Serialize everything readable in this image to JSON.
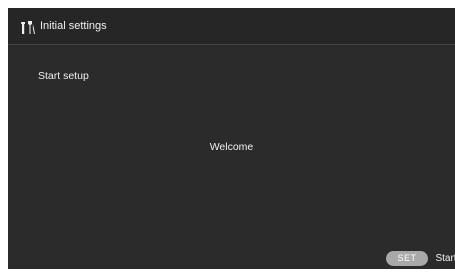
{
  "header": {
    "icon": "wrench-and-tools-icon",
    "title": "Initial settings"
  },
  "main": {
    "setup_label": "Start setup",
    "welcome_text": "Welcome"
  },
  "footer": {
    "set_button_label": "SET",
    "start_label": "Start"
  },
  "colors": {
    "background": "#2b2b2b",
    "header_background": "#262626",
    "set_button": "#a9a9a9",
    "text": "#f0f0f0"
  }
}
